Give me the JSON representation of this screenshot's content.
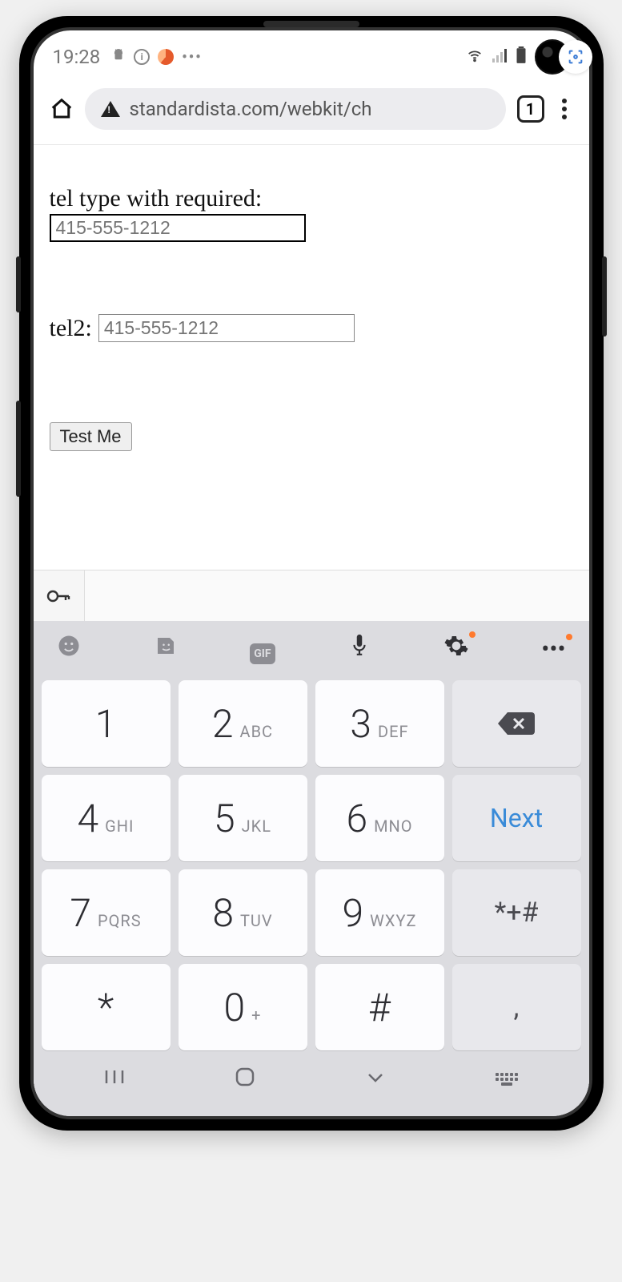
{
  "status": {
    "time": "19:28",
    "icons": {
      "android": "android-icon",
      "info": "info-icon",
      "swirl": "swirl-icon",
      "more": "more-horizontal-icon",
      "wifi": "wifi-icon",
      "signal": "signal-icon",
      "battery": "battery-icon",
      "camera": "front-camera"
    }
  },
  "browser": {
    "url": "standardista.com/webkit/ch",
    "tab_count": "1"
  },
  "page": {
    "field1": {
      "label": "tel type with required:",
      "placeholder": "415-555-1212"
    },
    "field2": {
      "label": "tel2:",
      "placeholder": "415-555-1212"
    },
    "button": "Test Me"
  },
  "keyboard": {
    "next": "Next",
    "symbols": "*+#",
    "comma": ",",
    "keys": [
      {
        "n": "1",
        "s": ""
      },
      {
        "n": "2",
        "s": "ABC"
      },
      {
        "n": "3",
        "s": "DEF"
      },
      {
        "n": "4",
        "s": "GHI"
      },
      {
        "n": "5",
        "s": "JKL"
      },
      {
        "n": "6",
        "s": "MNO"
      },
      {
        "n": "7",
        "s": "PQRS"
      },
      {
        "n": "8",
        "s": "TUV"
      },
      {
        "n": "9",
        "s": "WXYZ"
      },
      {
        "n": "*",
        "s": ""
      },
      {
        "n": "0",
        "s": "+"
      },
      {
        "n": "#",
        "s": ""
      }
    ]
  }
}
